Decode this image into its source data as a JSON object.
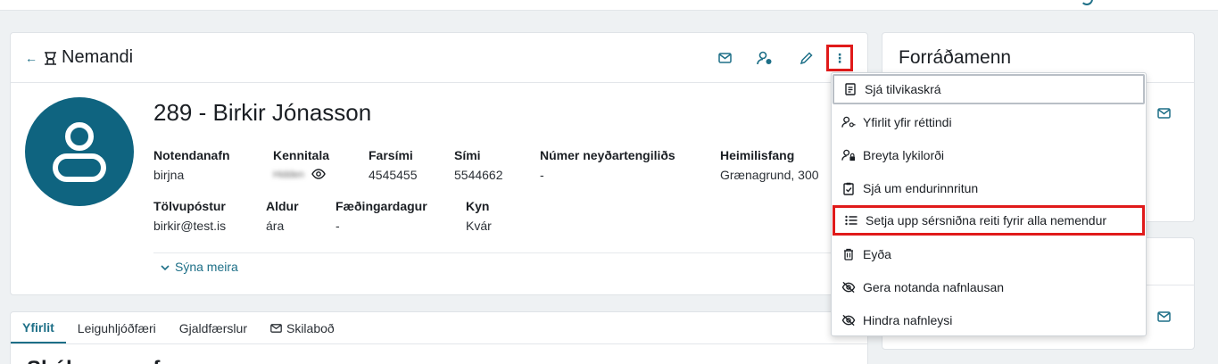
{
  "header": {
    "back_icon": "arrow-left-icon",
    "student_icon": "student-icon",
    "title": "Nemandi",
    "actions": [
      "mail-icon",
      "user-settings-icon",
      "pencil-icon",
      "more-vertical-icon"
    ]
  },
  "student": {
    "name": "289 - Birkir Jónasson",
    "fields_row1": [
      {
        "label": "Notendanafn",
        "value": "birjna"
      },
      {
        "label": "Kennitala",
        "value": "Hidden"
      },
      {
        "label": "Farsími",
        "value": "4545455"
      },
      {
        "label": "Sími",
        "value": "5544662"
      },
      {
        "label": "Númer neyðartengiliðs",
        "value": "-"
      },
      {
        "label": "Heimilisfang",
        "value": "Grænagrund, 300"
      }
    ],
    "fields_row2": [
      {
        "label": "Tölvupóstur",
        "value": "birkir@test.is"
      },
      {
        "label": "Aldur",
        "value": "ára"
      },
      {
        "label": "Fæðingardagur",
        "value": "-"
      },
      {
        "label": "Kyn",
        "value": "Kvár"
      }
    ],
    "show_more": "Sýna meira"
  },
  "tabs": [
    {
      "label": "Yfirlit",
      "active": true
    },
    {
      "label": "Leiguhljóðfæri",
      "active": false
    },
    {
      "label": "Gjaldfærslur",
      "active": false
    },
    {
      "label": "Skilaboð",
      "active": false,
      "icon": "mail-icon"
    }
  ],
  "section_title": "Skólaganga f",
  "side": {
    "guardians_title": "Forráðamenn"
  },
  "menu": [
    {
      "label": "Sjá tilvikaskrá",
      "icon": "document-icon"
    },
    {
      "label": "Yfirlit yfir réttindi",
      "icon": "user-key-icon"
    },
    {
      "label": "Breyta lykilorði",
      "icon": "user-lock-icon"
    },
    {
      "label": "Sjá um endurinnritun",
      "icon": "clipboard-check-icon"
    },
    {
      "label": "Setja upp sérsniðna reiti fyrir alla nemendur",
      "icon": "list-icon"
    },
    {
      "label": "Eyða",
      "icon": "trash-icon"
    },
    {
      "label": "Gera notanda nafnlausan",
      "icon": "eye-off-icon"
    },
    {
      "label": "Hindra nafnleysi",
      "icon": "eye-off-icon"
    }
  ],
  "colors": {
    "accent": "#1d6f87",
    "avatar": "#0f6480",
    "highlight": "#e01a1a"
  }
}
